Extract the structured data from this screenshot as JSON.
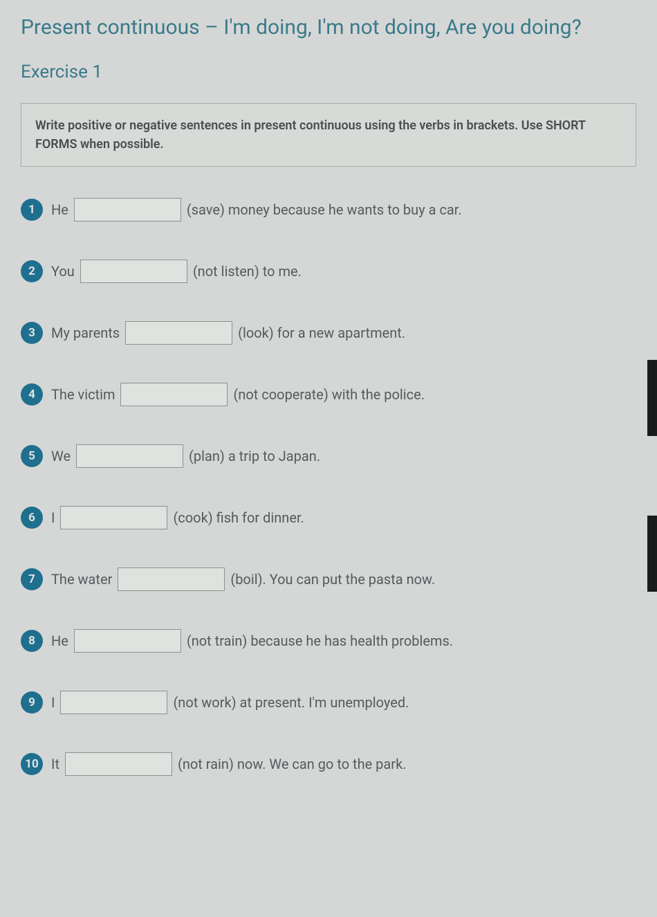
{
  "title": "Present continuous – I'm doing, I'm not doing, Are you doing?",
  "exercise_heading": "Exercise 1",
  "instructions": "Write positive or negative sentences in present continuous using the verbs in brackets. Use SHORT FORMS when possible.",
  "questions": [
    {
      "num": "1",
      "subject": "He",
      "trailing": "(save) money because he wants to buy a car."
    },
    {
      "num": "2",
      "subject": "You",
      "trailing": "(not listen) to me."
    },
    {
      "num": "3",
      "subject": "My parents",
      "trailing": "(look) for a new apartment."
    },
    {
      "num": "4",
      "subject": "The victim",
      "trailing": "(not cooperate) with the police."
    },
    {
      "num": "5",
      "subject": "We",
      "trailing": "(plan) a trip to Japan."
    },
    {
      "num": "6",
      "subject": "I",
      "trailing": "(cook) fish for dinner."
    },
    {
      "num": "7",
      "subject": "The water",
      "trailing": "(boil). You can put the pasta now."
    },
    {
      "num": "8",
      "subject": "He",
      "trailing": "(not train) because he has health problems."
    },
    {
      "num": "9",
      "subject": "I",
      "trailing": "(not work) at present. I'm unemployed."
    },
    {
      "num": "10",
      "subject": "It",
      "trailing": "(not rain) now. We can go to the park."
    }
  ]
}
